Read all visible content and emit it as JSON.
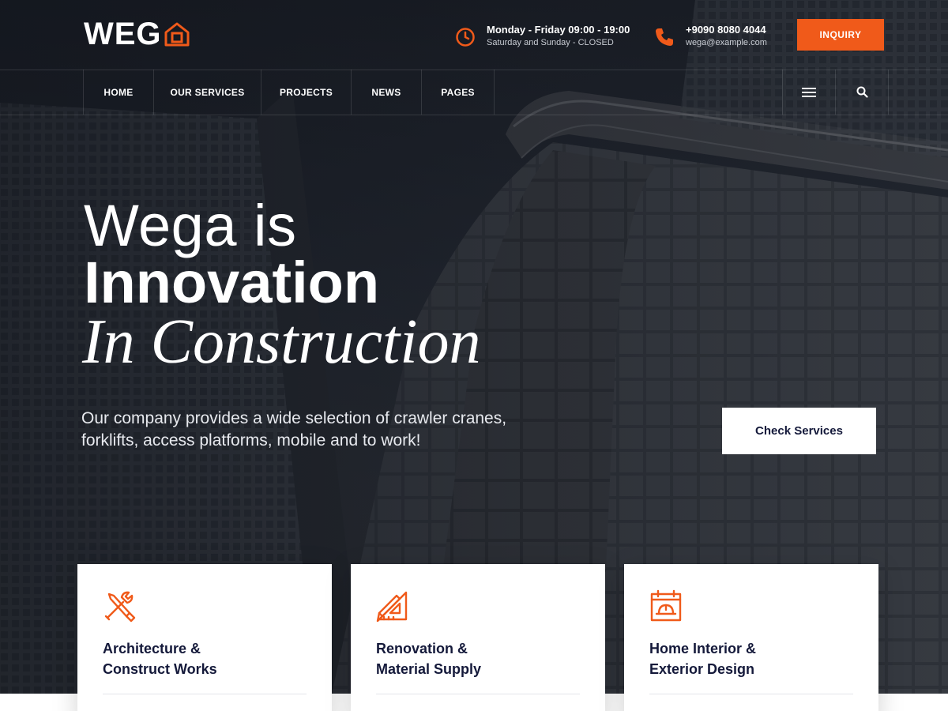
{
  "brand": {
    "logo_text": "WEG",
    "accent": "#f05a1a",
    "navy": "#14193a"
  },
  "topbar": {
    "hours": {
      "icon": "clock-icon",
      "line1": "Monday - Friday 09:00 - 19:00",
      "line2": "Saturday and Sunday - CLOSED"
    },
    "contact": {
      "icon": "phone-icon",
      "line1": "+9090 8080 4044",
      "line2": "wega@example.com"
    },
    "inquiry_label": "INQUIRY"
  },
  "nav": {
    "items": [
      {
        "label": "HOME"
      },
      {
        "label": "OUR SERVICES"
      },
      {
        "label": "PROJECTS"
      },
      {
        "label": "NEWS"
      },
      {
        "label": "PAGES"
      }
    ],
    "tools": [
      "menu-icon",
      "search-icon"
    ]
  },
  "hero": {
    "line1": "Wega is",
    "line2": "Innovation",
    "line3": "In Construction",
    "lead": "Our company provides a wide selection of crawler cranes, forklifts, access platforms, mobile and to work!",
    "cta_label": "Check Services"
  },
  "services": [
    {
      "icon": "tools-icon",
      "title": "Architecture &\nConstruct Works"
    },
    {
      "icon": "ruler-pencil-icon",
      "title": "Renovation &\nMaterial Supply"
    },
    {
      "icon": "hardhat-calendar-icon",
      "title": "Home Interior &\nExterior Design"
    }
  ]
}
